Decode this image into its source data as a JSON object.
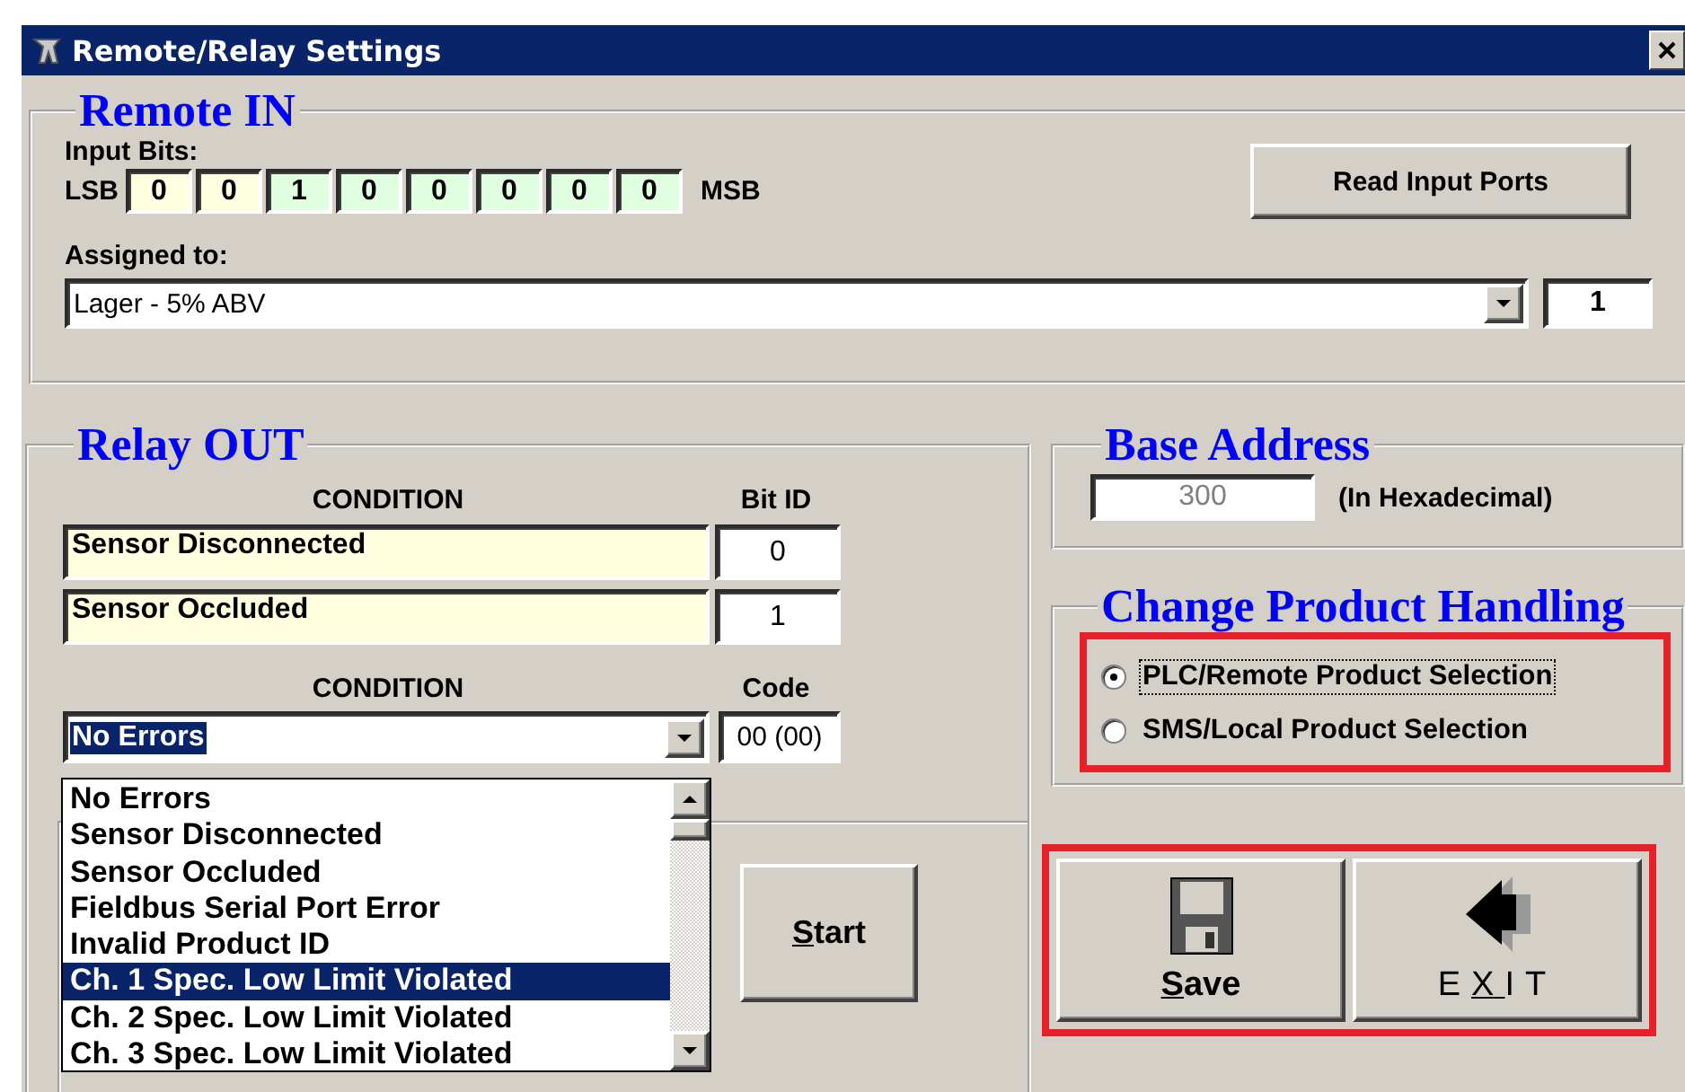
{
  "window": {
    "title": "Remote/Relay Settings"
  },
  "remote_in": {
    "title": "Remote IN",
    "input_bits_label": "Input Bits:",
    "lsb": "LSB",
    "msb": "MSB",
    "bits": [
      {
        "value": "0",
        "color": "#ffffe0"
      },
      {
        "value": "0",
        "color": "#ffffe0"
      },
      {
        "value": "1",
        "color": "#e0ffe0"
      },
      {
        "value": "0",
        "color": "#e0ffe0"
      },
      {
        "value": "0",
        "color": "#e0ffe0"
      },
      {
        "value": "0",
        "color": "#e0ffe0"
      },
      {
        "value": "0",
        "color": "#e0ffe0"
      },
      {
        "value": "0",
        "color": "#e0ffe0"
      }
    ],
    "read_button": "Read Input Ports",
    "assigned_label": "Assigned to:",
    "assigned_value": "Lager - 5% ABV",
    "assigned_number": "1"
  },
  "relay_out": {
    "title": "Relay OUT",
    "condition_header": "CONDITION",
    "bit_header": "Bit ID",
    "conditions": [
      {
        "name": "Sensor Disconnected",
        "bit": "0"
      },
      {
        "name": "Sensor Occluded",
        "bit": "1"
      }
    ],
    "condition_header_2": "CONDITION",
    "code_header": "Code",
    "selected_condition": "No Errors",
    "code": "00 (00)",
    "dropdown": {
      "expanded": true,
      "options": [
        {
          "label": "No Errors",
          "selected": false
        },
        {
          "label": "Sensor Disconnected",
          "selected": false
        },
        {
          "label": "Sensor Occluded",
          "selected": false
        },
        {
          "label": "Fieldbus Serial Port Error",
          "selected": false
        },
        {
          "label": "Invalid Product ID",
          "selected": false
        },
        {
          "label": "Ch. 1 Spec. Low Limit Violated",
          "selected": true
        },
        {
          "label": "Ch. 2 Spec. Low Limit Violated",
          "selected": false
        },
        {
          "label": "Ch. 3 Spec. Low Limit Violated",
          "selected": false
        }
      ]
    },
    "start_button": {
      "label": "Start"
    }
  },
  "base_address": {
    "title": "Base Address",
    "value": "300",
    "disabled": true,
    "note": "(In Hexadecimal)"
  },
  "product_handling": {
    "title": "Change Product Handling",
    "highlighted": true,
    "options": [
      {
        "label": "PLC/Remote Product Selection",
        "selected": true
      },
      {
        "label": "SMS/Local Product Selection",
        "selected": false
      }
    ]
  },
  "actions": {
    "highlighted": true,
    "buttons": [
      {
        "kind": "save",
        "label": "Save"
      },
      {
        "kind": "exit",
        "label": "EXIT"
      }
    ]
  }
}
